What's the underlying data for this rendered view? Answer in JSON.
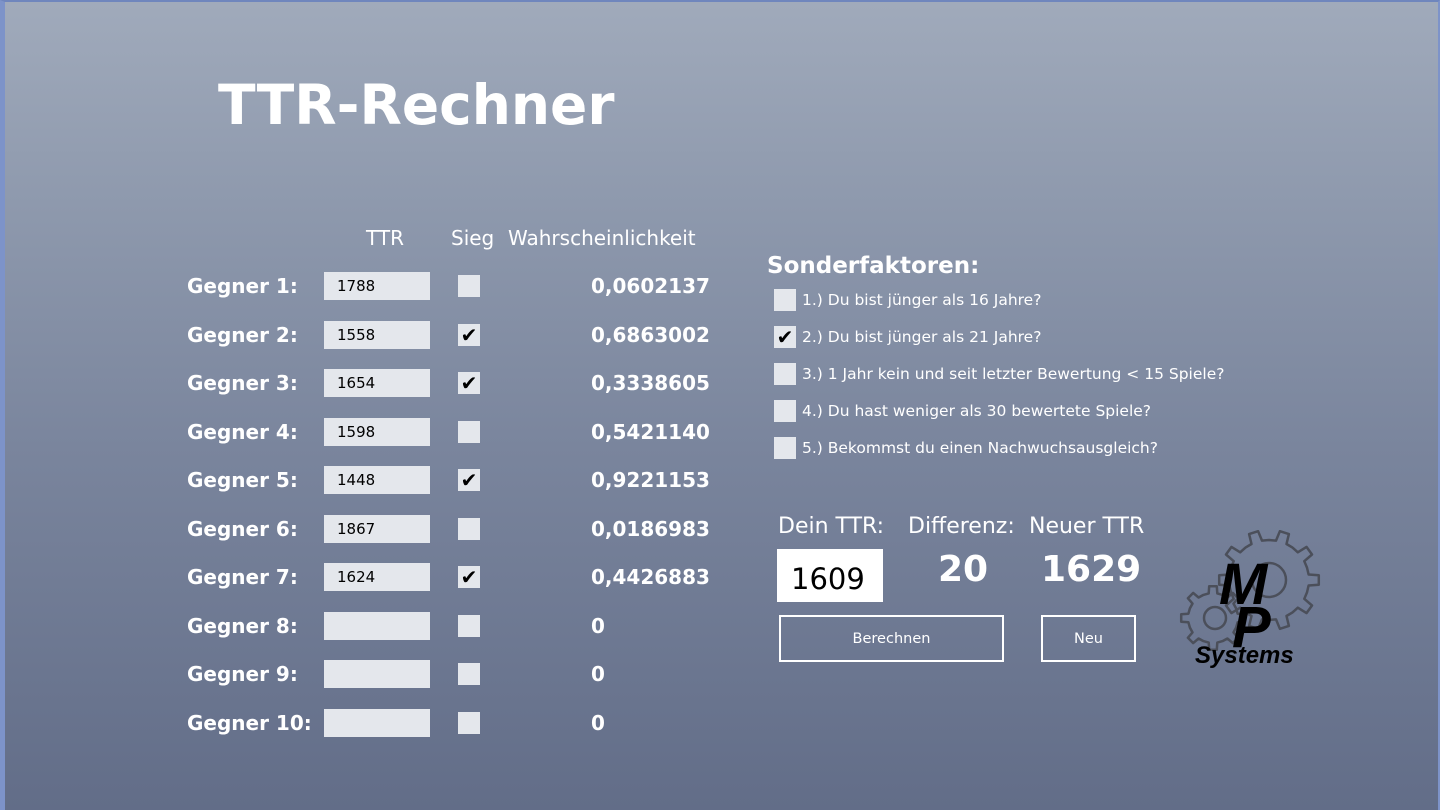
{
  "title": "TTR-Rechner",
  "columns": {
    "ttr": "TTR",
    "sieg": "Sieg",
    "prob": "Wahrscheinlichkeit"
  },
  "opponents": [
    {
      "label": "Gegner 1:",
      "ttr": "1788",
      "win": false,
      "prob": "0,0602137"
    },
    {
      "label": "Gegner 2:",
      "ttr": "1558",
      "win": true,
      "prob": "0,6863002"
    },
    {
      "label": "Gegner 3:",
      "ttr": "1654",
      "win": true,
      "prob": "0,3338605"
    },
    {
      "label": "Gegner 4:",
      "ttr": "1598",
      "win": false,
      "prob": "0,5421140"
    },
    {
      "label": "Gegner 5:",
      "ttr": "1448",
      "win": true,
      "prob": "0,9221153"
    },
    {
      "label": "Gegner 6:",
      "ttr": "1867",
      "win": false,
      "prob": "0,0186983"
    },
    {
      "label": "Gegner 7:",
      "ttr": "1624",
      "win": true,
      "prob": "0,4426883"
    },
    {
      "label": "Gegner 8:",
      "ttr": "",
      "win": false,
      "prob": "0"
    },
    {
      "label": "Gegner 9:",
      "ttr": "",
      "win": false,
      "prob": "0"
    },
    {
      "label": "Gegner 10:",
      "ttr": "",
      "win": false,
      "prob": "0"
    }
  ],
  "sonderfaktoren": {
    "title": "Sonderfaktoren:",
    "items": [
      {
        "label": "1.) Du bist jünger als 16 Jahre?",
        "checked": false
      },
      {
        "label": "2.) Du bist jünger als 21 Jahre?",
        "checked": true
      },
      {
        "label": "3.) 1 Jahr kein und seit letzter Bewertung < 15 Spiele?",
        "checked": false
      },
      {
        "label": "4.) Du hast weniger als 30 bewertete Spiele?",
        "checked": false
      },
      {
        "label": "5.) Bekommst du einen Nachwuchsausgleich?",
        "checked": false
      }
    ]
  },
  "result": {
    "my_ttr_label": "Dein TTR:",
    "my_ttr_value": "1609",
    "diff_label": "Differenz:",
    "diff_value": "20",
    "new_label": "Neuer TTR",
    "new_value": "1629"
  },
  "buttons": {
    "calculate": "Berechnen",
    "new": "Neu"
  },
  "logo": {
    "letters_top": "M",
    "letters_mid": "P",
    "wordmark": "Systems"
  },
  "icons": {
    "check": "checkmark-icon",
    "logo": "gear-logo-icon"
  }
}
